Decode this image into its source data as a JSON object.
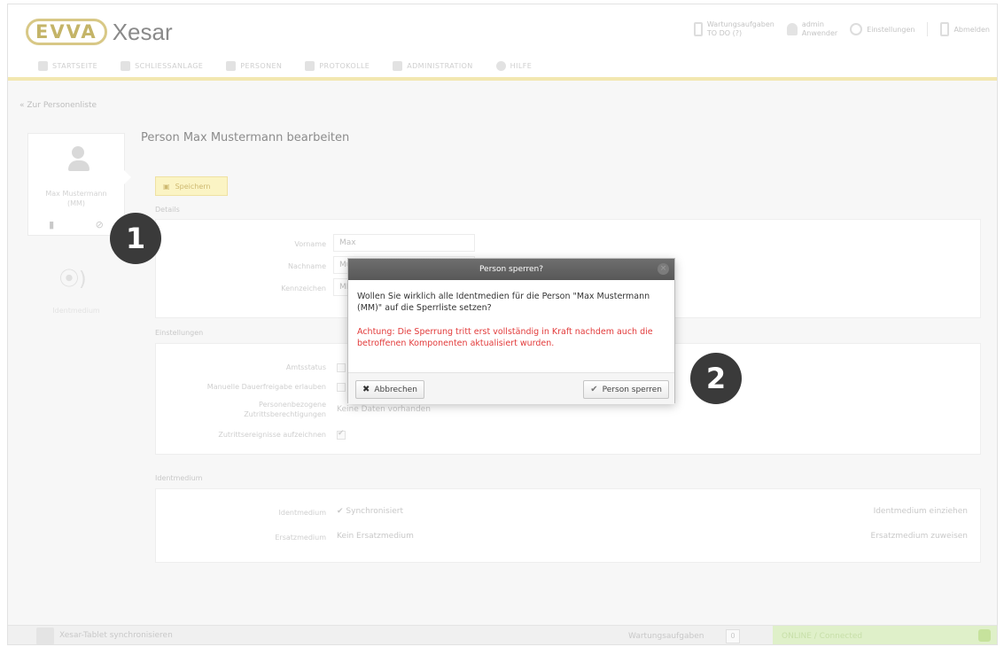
{
  "header": {
    "logo_brand": "EVVA",
    "logo_product": "Xesar",
    "status_line1": "Wartungsaufgaben",
    "status_line2": "TO DO (?)",
    "user_line1": "admin",
    "user_line2": "Anwender",
    "settings_label": "Einstellungen",
    "logout_label": "Abmelden"
  },
  "nav": {
    "items": [
      {
        "label": "STARTSEITE"
      },
      {
        "label": "SCHLIESSANLAGE"
      },
      {
        "label": "PERSONEN"
      },
      {
        "label": "PROTOKOLLE"
      },
      {
        "label": "ADMINISTRATION"
      },
      {
        "label": "HILFE"
      }
    ]
  },
  "back_link": "Zur Personenliste",
  "sidebar": {
    "person_name": "Max Mustermann",
    "person_short": "(MM)",
    "media_label": "Identmedium"
  },
  "page": {
    "title": "Person Max Mustermann bearbeiten",
    "save_label": "Speichern",
    "section_details": "Details",
    "fields": {
      "first_name_label": "Vorname",
      "first_name_value": "Max",
      "last_name_label": "Nachname",
      "last_name_value": "Mu",
      "short_label": "Kennzeichen",
      "short_value": "MM"
    },
    "section_settings": "Einstellungen",
    "settings": {
      "office_label": "Amtsstatus",
      "manual_label": "Manuelle Dauerfreigabe erlauben",
      "groups_label_1": "Personenbezogene",
      "groups_label_2": "Zutrittsberechtigungen",
      "groups_value": "Keine Daten vorhanden",
      "events_label": "Zutrittsereignisse aufzeichnen"
    },
    "section_media": "Identmedium",
    "media": {
      "media_label": "Identmedium",
      "media_value": "Synchronisiert",
      "media_action": "Identmedium einziehen",
      "replace_label": "Ersatzmedium",
      "replace_value": "Kein Ersatzmedium",
      "replace_action": "Ersatzmedium zuweisen"
    }
  },
  "dialog": {
    "title": "Person sperren?",
    "message": "Wollen Sie wirklich alle Identmedien für die Person \"Max Mustermann (MM)\" auf die Sperrliste setzen?",
    "warning": "Achtung: Die Sperrung tritt erst vollständig in Kraft nachdem auch die betroffenen Komponenten aktualisiert wurden.",
    "cancel_label": "Abbrechen",
    "confirm_label": "Person sperren"
  },
  "statusbar": {
    "sync_label": "Xesar-Tablet synchronisieren",
    "maintenance_label": "Wartungsaufgaben",
    "maintenance_count": "0",
    "online_label": "ONLINE / Connected"
  },
  "callouts": [
    "1",
    "2"
  ]
}
